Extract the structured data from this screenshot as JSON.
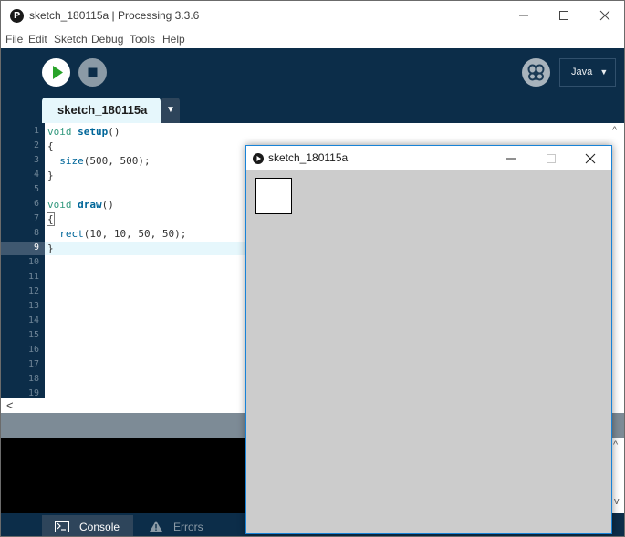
{
  "window": {
    "app_icon_glyph": "P",
    "title": "sketch_180115a | Processing 3.3.6",
    "controls": [
      "minimize-icon",
      "maximize-icon",
      "close-icon"
    ]
  },
  "menubar": {
    "items": [
      "File",
      "Edit",
      "Sketch",
      "Debug",
      "Tools",
      "Help"
    ]
  },
  "toolbar": {
    "run_icon": "play-icon",
    "stop_icon": "stop-icon",
    "debugger_icon": "butterfly-icon",
    "mode_label": "Java",
    "mode_arrow": "▼"
  },
  "tabs": {
    "active_label": "sketch_180115a",
    "menu_arrow": "▼"
  },
  "editor": {
    "line_numbers": [
      "1",
      "2",
      "3",
      "4",
      "5",
      "6",
      "7",
      "8",
      "9",
      "10",
      "11",
      "12",
      "13",
      "14",
      "15",
      "16",
      "17",
      "18",
      "19"
    ],
    "current_line": "9",
    "code": {
      "l1_kw": "void",
      "l1_fn": "setup",
      "l1_rest": "()",
      "l2": "{",
      "l3_indent": "  ",
      "l3_fn": "size",
      "l3_rest": "(500, 500);",
      "l4": "}",
      "l6_kw": "void",
      "l6_fn": "draw",
      "l6_rest": "()",
      "l7": "{",
      "l8_indent": "  ",
      "l8_fn": "rect",
      "l8_rest": "(10, 10, 50, 50);",
      "l9": "}"
    }
  },
  "scrollbars": {
    "left_arrow": "<",
    "up_arrow": "^",
    "down_arrow": "v"
  },
  "footer": {
    "console_label": "Console",
    "errors_label": "Errors"
  },
  "sketch_window": {
    "title": "sketch_180115a",
    "background_color": "#cccccc",
    "controls": [
      "minimize-icon",
      "maximize-icon",
      "close-icon"
    ]
  },
  "colors": {
    "toolbar_bg": "#0c2d49",
    "run_button": "#ffffff",
    "run_icon": "#29a329",
    "active_tab": "#e6f7fc",
    "keyword": "#33997e",
    "function": "#006699"
  }
}
